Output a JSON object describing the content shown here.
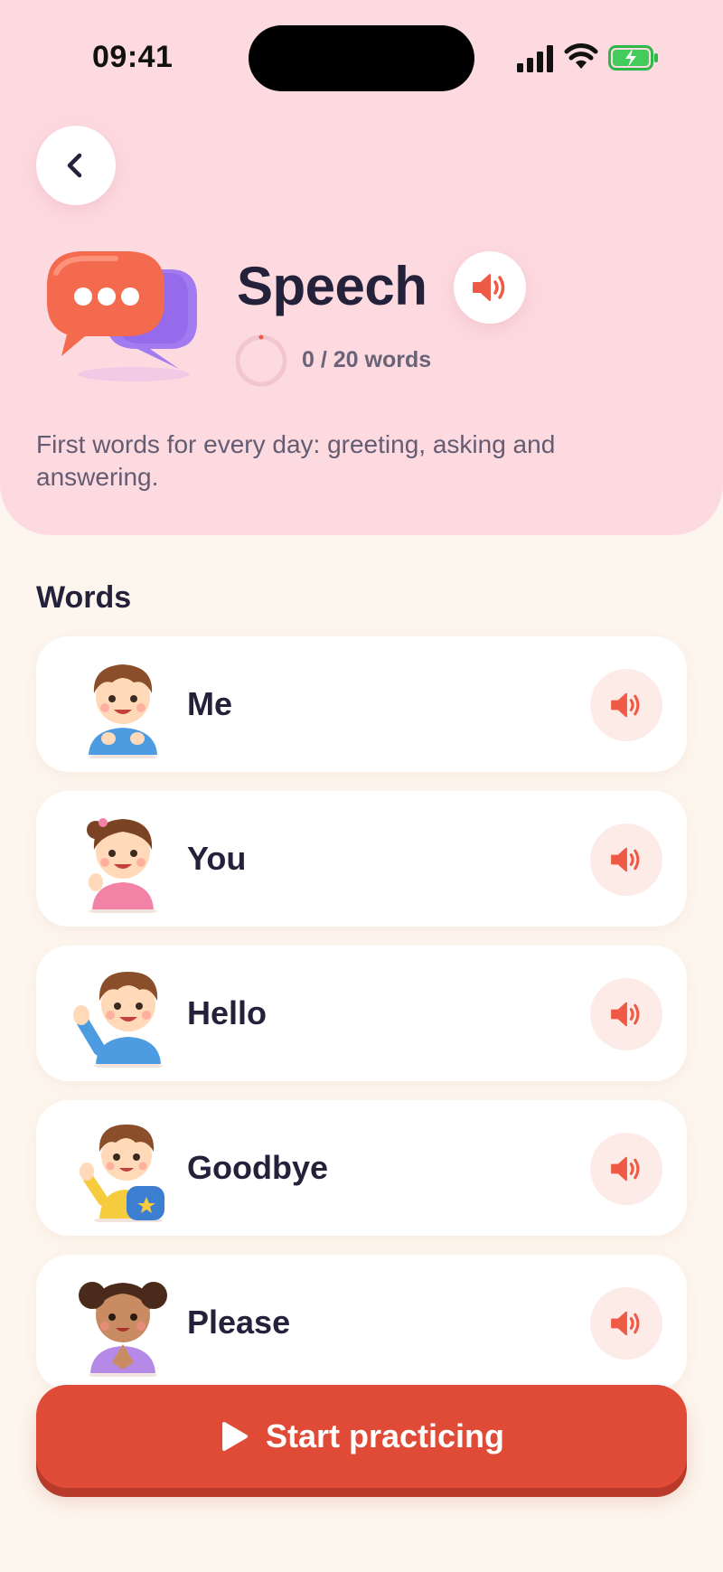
{
  "status_bar": {
    "time": "09:41"
  },
  "header": {
    "title": "Speech",
    "progress": {
      "completed": 0,
      "total": 20,
      "text": "0 / 20 words"
    },
    "description": "First words for every day: greeting, asking and answering."
  },
  "words_section": {
    "title": "Words",
    "items": [
      {
        "label": "Me",
        "icon": "boy-pointing-self-icon"
      },
      {
        "label": "You",
        "icon": "girl-pointing-icon"
      },
      {
        "label": "Hello",
        "icon": "boy-waving-icon"
      },
      {
        "label": "Goodbye",
        "icon": "boy-backpack-waving-icon"
      },
      {
        "label": "Please",
        "icon": "girl-praying-hands-icon"
      }
    ]
  },
  "start_button": {
    "label": "Start practicing",
    "icon": "play-icon"
  },
  "colors": {
    "header_bg": "#FDDAE0",
    "page_bg": "#FDF6EE",
    "accent": "#DF4B37",
    "speaker": "#EE5A45",
    "text_dark": "#24213A"
  }
}
